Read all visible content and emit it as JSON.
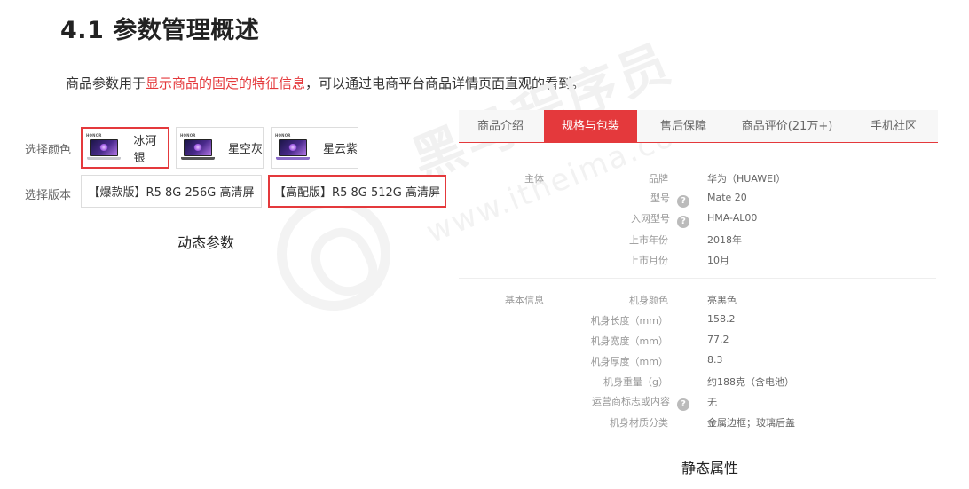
{
  "title": "4.1 参数管理概述",
  "intro": {
    "prefix": "商品参数用于",
    "highlight": "显示商品的固定的特征信息",
    "suffix": "，可以通过电商平台商品详情页面直观的看到。"
  },
  "dynamic": {
    "color_label": "选择颜色",
    "version_label": "选择版本",
    "colors": [
      {
        "label": "冰河银",
        "brand": "HONOR",
        "selected": true
      },
      {
        "label": "星空灰",
        "brand": "HONOR",
        "selected": false
      },
      {
        "label": "星云紫",
        "brand": "HONOR",
        "selected": false
      }
    ],
    "versions": [
      {
        "label": "【爆款版】R5 8G 256G 高清屏",
        "selected": false
      },
      {
        "label": "【高配版】R5 8G 512G 高清屏",
        "selected": true
      }
    ],
    "caption": "动态参数"
  },
  "watermark": {
    "text": "黑马程序员",
    "url": "www.itheima.com"
  },
  "static": {
    "tabs": [
      {
        "label": "商品介绍",
        "active": false
      },
      {
        "label": "规格与包装",
        "active": true
      },
      {
        "label": "售后保障",
        "active": false
      },
      {
        "label": "商品评价(21万+)",
        "active": false
      },
      {
        "label": "手机社区",
        "active": false
      }
    ],
    "groups": [
      {
        "name": "主体",
        "rows": [
          {
            "name": "品牌",
            "value": "华为（HUAWEI）",
            "help": false
          },
          {
            "name": "型号",
            "value": "Mate 20",
            "help": true
          },
          {
            "name": "入网型号",
            "value": "HMA-AL00",
            "help": true
          },
          {
            "name": "上市年份",
            "value": "2018年",
            "help": false
          },
          {
            "name": "上市月份",
            "value": "10月",
            "help": false
          }
        ]
      },
      {
        "name": "基本信息",
        "rows": [
          {
            "name": "机身颜色",
            "value": "亮黑色",
            "help": false
          },
          {
            "name": "机身长度（mm）",
            "value": "158.2",
            "help": false
          },
          {
            "name": "机身宽度（mm）",
            "value": "77.2",
            "help": false
          },
          {
            "name": "机身厚度（mm）",
            "value": "8.3",
            "help": false
          },
          {
            "name": "机身重量（g）",
            "value": "约188克（含电池）",
            "help": false
          },
          {
            "name": "运营商标志或内容",
            "value": "无",
            "help": true
          },
          {
            "name": "机身材质分类",
            "value": "金属边框；玻璃后盖",
            "help": false
          }
        ]
      }
    ],
    "caption": "静态属性",
    "help_icon": "question-circle-icon"
  },
  "colors": {
    "accent": "#e4393c",
    "tab_bg": "#f7f7f7"
  }
}
